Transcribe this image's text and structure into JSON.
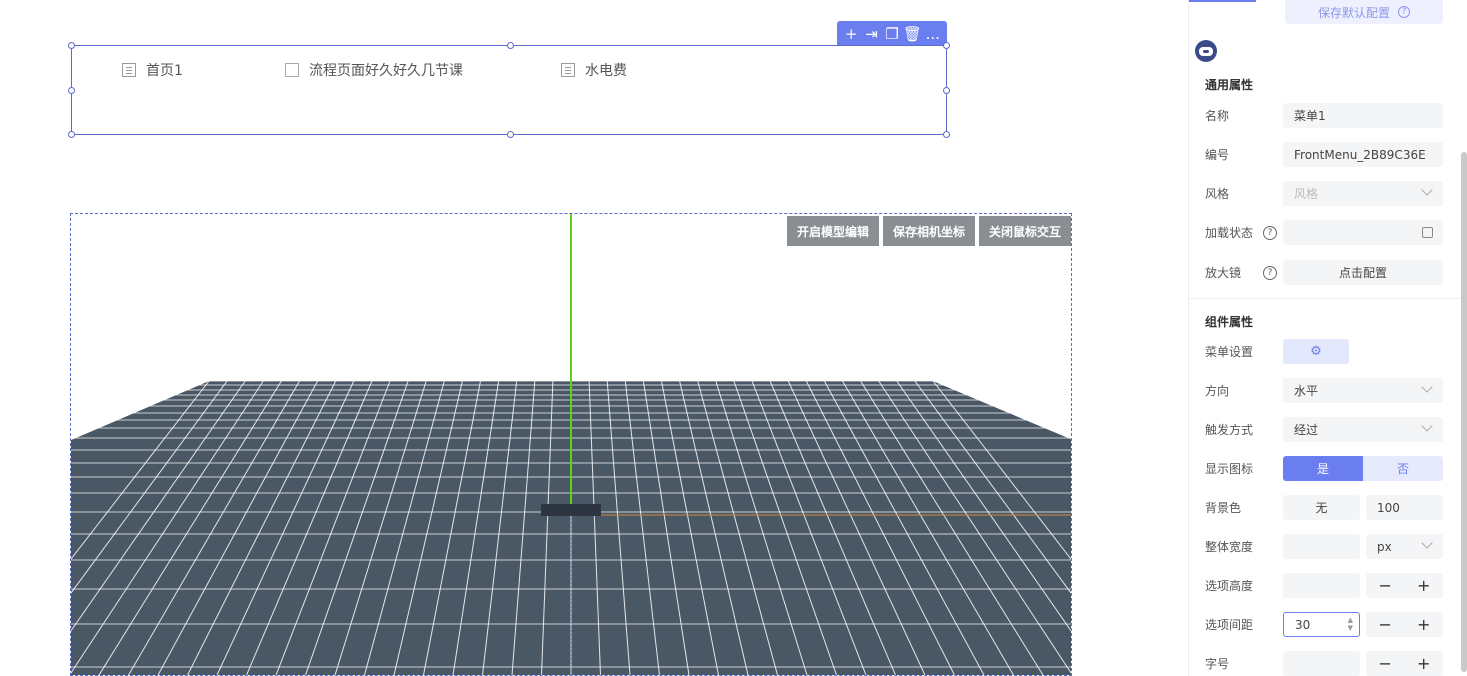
{
  "menu": {
    "items": [
      {
        "label": "首页1",
        "icon": "grid-icon"
      },
      {
        "label": "流程页面好久好久几节课",
        "icon": "checkbox-icon"
      },
      {
        "label": "水电费",
        "icon": "grid-icon"
      }
    ],
    "toolbar": {
      "add": "+",
      "move": "⇥",
      "copy": "❐",
      "delete": "🗑",
      "more": "..."
    }
  },
  "scene": {
    "buttons": [
      "开启模型编辑",
      "保存相机坐标",
      "关闭鼠标交互"
    ],
    "colors": {
      "floor": "#4a5866",
      "grid_line": "#ffffff",
      "y_axis": "#5cd316",
      "x_axis": "#d28a3a"
    }
  },
  "panel": {
    "save_default": "保存默认配置",
    "general_title": "通用属性",
    "component_title": "组件属性",
    "fields": {
      "name_label": "名称",
      "name_value": "菜单1",
      "id_label": "编号",
      "id_value": "FrontMenu_2B89C36E",
      "style_label": "风格",
      "style_placeholder": "风格",
      "loading_label": "加载状态",
      "magnifier_label": "放大镜",
      "magnifier_value": "点击配置",
      "menu_settings_label": "菜单设置",
      "direction_label": "方向",
      "direction_value": "水平",
      "trigger_label": "触发方式",
      "trigger_value": "经过",
      "show_icon_label": "显示图标",
      "show_icon_yes": "是",
      "show_icon_no": "否",
      "bg_label": "背景色",
      "bg_value": "无",
      "bg_opacity": "100",
      "width_label": "整体宽度",
      "width_unit": "px",
      "item_height_label": "选项高度",
      "item_gap_label": "选项间距",
      "item_gap_value": "30",
      "font_size_label": "字号"
    },
    "accent": "#6b7ef0"
  }
}
